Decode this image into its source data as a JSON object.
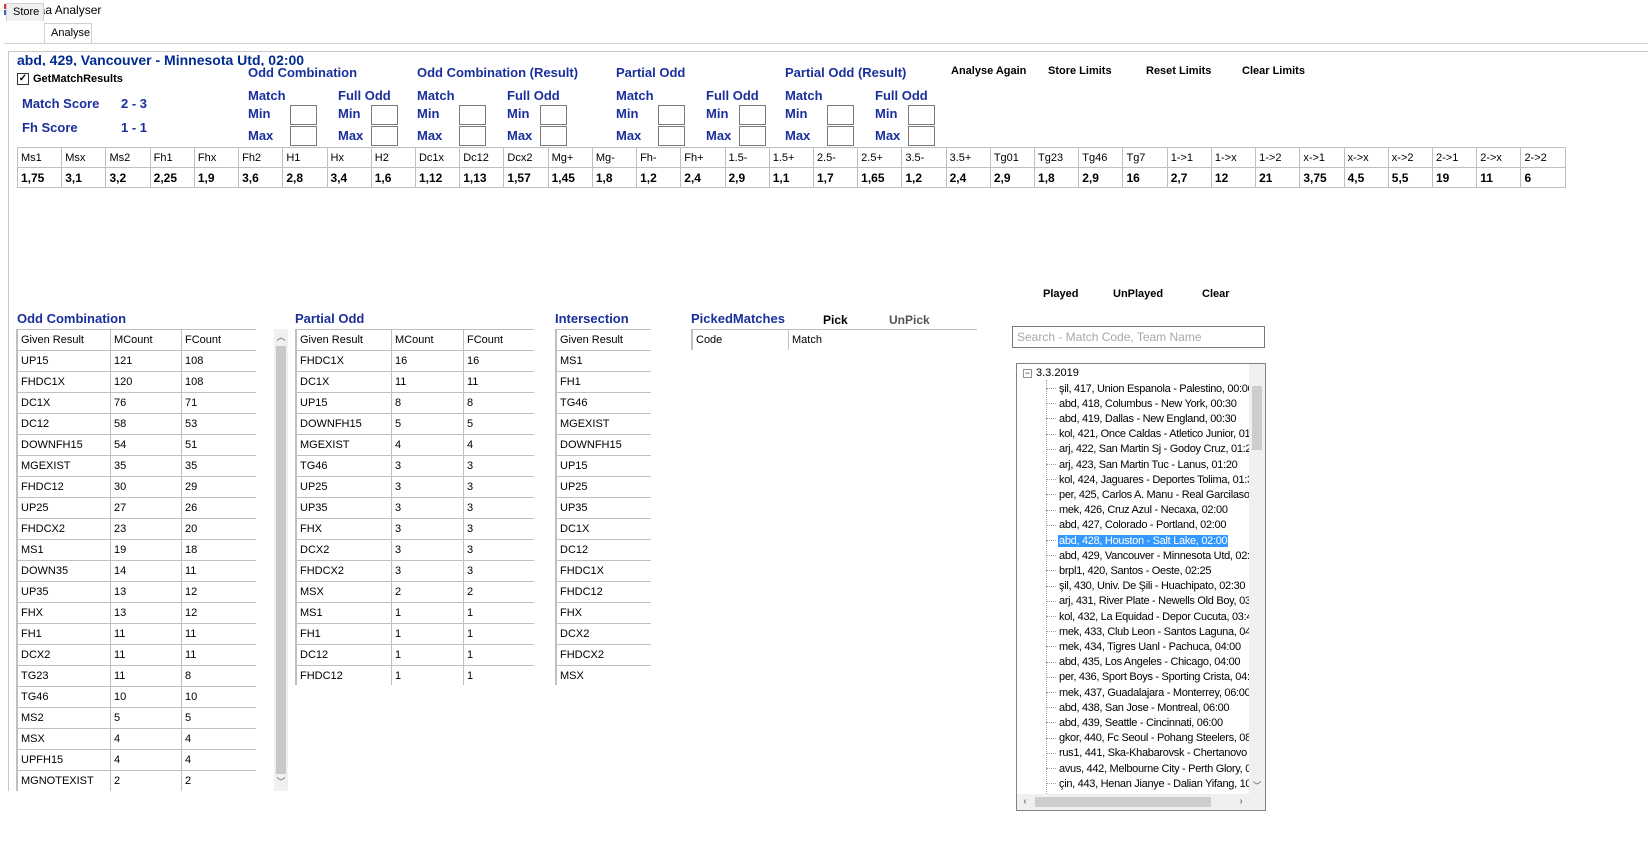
{
  "window": {
    "title": "Iddaa Analyser"
  },
  "tabs": [
    {
      "label": "Store"
    },
    {
      "label": "Analyse"
    }
  ],
  "match": {
    "title": "abd, 429, Vancouver - Minnesota Utd, 02:00",
    "get_results_label": "GetMatchResults",
    "get_results_checked": true,
    "score_label": "Match Score",
    "score_value": "2 - 3",
    "fh_label": "Fh Score",
    "fh_value": "1 - 1"
  },
  "filter_groups": [
    {
      "title": "Odd Combination",
      "match": "Match",
      "full": "Full Odd",
      "min": "Min",
      "max": "Max"
    },
    {
      "title": "Odd Combination (Result)",
      "match": "Match",
      "full": "Full Odd",
      "min": "Min",
      "max": "Max"
    },
    {
      "title": "Partial Odd",
      "match": "Match",
      "full": "Full Odd",
      "min": "Min",
      "max": "Max"
    },
    {
      "title": "Partial Odd (Result)",
      "match": "Match",
      "full": "Full Odd",
      "min": "Min",
      "max": "Max"
    }
  ],
  "actions": {
    "analyse_again": "Analyse Again",
    "store_limits": "Store Limits",
    "reset_limits": "Reset Limits",
    "clear_limits": "Clear Limits"
  },
  "odds": {
    "headers": [
      "Ms1",
      "Msx",
      "Ms2",
      "Fh1",
      "Fhx",
      "Fh2",
      "H1",
      "Hx",
      "H2",
      "Dc1x",
      "Dc12",
      "Dcx2",
      "Mg+",
      "Mg-",
      "Fh-",
      "Fh+",
      "1.5-",
      "1.5+",
      "2.5-",
      "2.5+",
      "3.5-",
      "3.5+",
      "Tg01",
      "Tg23",
      "Tg46",
      "Tg7",
      "1->1",
      "1->x",
      "1->2",
      "x->1",
      "x->x",
      "x->2",
      "2->1",
      "2->x",
      "2->2"
    ],
    "values": [
      "1,75",
      "3,1",
      "3,2",
      "2,25",
      "1,9",
      "3,6",
      "2,8",
      "3,4",
      "1,6",
      "1,12",
      "1,13",
      "1,57",
      "1,45",
      "1,8",
      "1,2",
      "2,4",
      "2,9",
      "1,1",
      "1,7",
      "1,65",
      "1,2",
      "2,4",
      "2,9",
      "1,8",
      "2,9",
      "16",
      "2,7",
      "12",
      "21",
      "3,75",
      "4,5",
      "5,5",
      "19",
      "11",
      "6"
    ]
  },
  "odd_combination": {
    "title": "Odd Combination",
    "headers": [
      "Given Result",
      "MCount",
      "FCount"
    ],
    "rows": [
      [
        "UP15",
        "121",
        "108"
      ],
      [
        "FHDC1X",
        "120",
        "108"
      ],
      [
        "DC1X",
        "76",
        "71"
      ],
      [
        "DC12",
        "58",
        "53"
      ],
      [
        "DOWNFH15",
        "54",
        "51"
      ],
      [
        "MGEXIST",
        "35",
        "35"
      ],
      [
        "FHDC12",
        "30",
        "29"
      ],
      [
        "UP25",
        "27",
        "26"
      ],
      [
        "FHDCX2",
        "23",
        "20"
      ],
      [
        "MS1",
        "19",
        "18"
      ],
      [
        "DOWN35",
        "14",
        "11"
      ],
      [
        "UP35",
        "13",
        "12"
      ],
      [
        "FHX",
        "13",
        "12"
      ],
      [
        "FH1",
        "11",
        "11"
      ],
      [
        "DCX2",
        "11",
        "11"
      ],
      [
        "TG23",
        "11",
        "8"
      ],
      [
        "TG46",
        "10",
        "10"
      ],
      [
        "MS2",
        "5",
        "5"
      ],
      [
        "MSX",
        "4",
        "4"
      ],
      [
        "UPFH15",
        "4",
        "4"
      ],
      [
        "MGNOTEXIST",
        "2",
        "2"
      ]
    ]
  },
  "partial_odd": {
    "title": "Partial Odd",
    "headers": [
      "Given Result",
      "MCount",
      "FCount"
    ],
    "rows": [
      [
        "FHDC1X",
        "16",
        "16"
      ],
      [
        "DC1X",
        "11",
        "11"
      ],
      [
        "UP15",
        "8",
        "8"
      ],
      [
        "DOWNFH15",
        "5",
        "5"
      ],
      [
        "MGEXIST",
        "4",
        "4"
      ],
      [
        "TG46",
        "3",
        "3"
      ],
      [
        "UP25",
        "3",
        "3"
      ],
      [
        "UP35",
        "3",
        "3"
      ],
      [
        "FHX",
        "3",
        "3"
      ],
      [
        "DCX2",
        "3",
        "3"
      ],
      [
        "FHDCX2",
        "3",
        "3"
      ],
      [
        "MSX",
        "2",
        "2"
      ],
      [
        "MS1",
        "1",
        "1"
      ],
      [
        "FH1",
        "1",
        "1"
      ],
      [
        "DC12",
        "1",
        "1"
      ],
      [
        "FHDC12",
        "1",
        "1"
      ]
    ]
  },
  "intersection": {
    "title": "Intersection",
    "header": "Given Result",
    "rows": [
      "MS1",
      "FH1",
      "TG46",
      "MGEXIST",
      "DOWNFH15",
      "UP15",
      "UP25",
      "UP35",
      "DC1X",
      "DC12",
      "FHDC1X",
      "FHDC12",
      "FHX",
      "DCX2",
      "FHDCX2",
      "MSX"
    ]
  },
  "picked": {
    "title": "PickedMatches",
    "pick_label": "Pick",
    "unpick_label": "UnPick",
    "headers": [
      "Code",
      "Match"
    ]
  },
  "tree_actions": {
    "played": "Played",
    "unplayed": "UnPlayed",
    "clear": "Clear"
  },
  "search": {
    "placeholder": "Search - Match Code, Team Name",
    "value": ""
  },
  "tree": {
    "root": "3.3.2019",
    "selected_index": 10,
    "items": [
      "şil, 417, Union Espanola - Palestino, 00:00",
      "abd, 418, Columbus - New York, 00:30",
      "abd, 419, Dallas - New England, 00:30",
      "kol, 421, Once Caldas - Atletico Junior, 01:",
      "arj, 422, San Martin Sj - Godoy Cruz, 01:20",
      "arj, 423, San Martin Tuc - Lanus, 01:20",
      "kol, 424, Jaguares - Deportes Tolima, 01:3",
      "per, 425, Carlos A. Manu - Real Garcilaso,",
      "mek, 426, Cruz Azul - Necaxa, 02:00",
      "abd, 427, Colorado - Portland, 02:00",
      "abd, 428, Houston - Salt Lake, 02:00",
      "abd, 429, Vancouver - Minnesota Utd, 02:",
      "brpl1, 420, Santos - Oeste, 02:25",
      "şil, 430, Univ. De Şili - Huachipato, 02:30",
      "arj, 431, River Plate - Newells Old Boy, 03:",
      "kol, 432, La Equidad - Depor Cucuta, 03:4",
      "mek, 433, Club Leon - Santos Laguna, 04:",
      "mek, 434, Tigres Uanl - Pachuca, 04:00",
      "abd, 435, Los Angeles - Chicago, 04:00",
      "per, 436, Sport Boys - Sporting Crista, 04:0",
      "mek, 437, Guadalajara - Monterrey, 06:00",
      "abd, 438, San Jose - Montreal, 06:00",
      "abd, 439, Seattle - Cincinnati, 06:00",
      "gkor, 440, Fc Seoul - Pohang Steelers, 08",
      "rus1, 441, Ska-Khabarovsk - Chertanovo M",
      "avus, 442, Melbourne City - Perth Glory, 09",
      "çin, 443, Henan Jianye - Dalian Yifang, 10"
    ]
  },
  "colors": {
    "accent": "#1a2f9c",
    "selection": "#3399ff"
  }
}
